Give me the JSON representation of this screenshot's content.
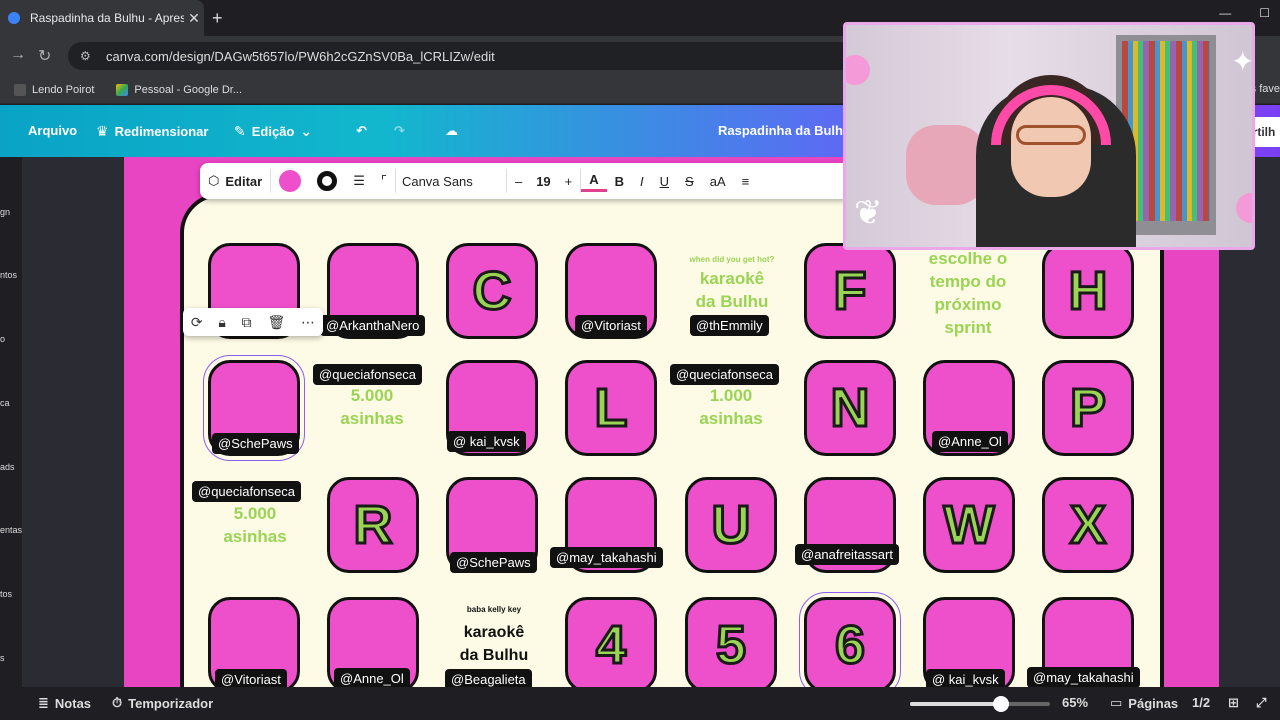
{
  "browser": {
    "tab_title": "Raspadinha da Bulhu - Apresen",
    "url": "canva.com/design/DAGw5t657lo/PW6h2cGZnSV0Ba_lCRLIZw/edit",
    "bookmarks": [
      "Lendo Poirot",
      "Pessoal - Google Dr..."
    ],
    "bookmarks_right": "os fave"
  },
  "canva_header": {
    "file": "Arquivo",
    "resize": "Redimensionar",
    "edit": "Edição",
    "doc_title": "Raspadinha da Bulhu",
    "share": "artilh"
  },
  "left_strip": [
    "gn",
    "ntos",
    "o",
    "ca",
    "ads",
    "entas",
    "tos",
    "s"
  ],
  "text_toolbar": {
    "edit": "Editar",
    "font": "Canva Sans",
    "size": "19",
    "minus": "–",
    "plus": "+",
    "bold": "B",
    "italic": "I",
    "underline": "U",
    "strike": "S",
    "case": "aA",
    "text_color": "#ee4fcb"
  },
  "grid": {
    "row1": {
      "c3": "C",
      "c6": "F",
      "c8": "H",
      "h2": "@ArkanthaNero",
      "h4": "@Vitoriast",
      "small5": "when did you get hot?",
      "txt5": [
        "karaokê",
        "da Bulhu"
      ],
      "h5": "@thEmmily",
      "txt7": [
        "escolhe o",
        "tempo do",
        "próximo",
        "sprint"
      ]
    },
    "row2": {
      "h1": "@SchePaws",
      "h2": "@queciafonseca",
      "txt2": [
        "5.000",
        "asinhas"
      ],
      "h3": "@ kai_kvsk",
      "c4": "L",
      "h5": "@queciafonseca",
      "txt5": [
        "1.000",
        "asinhas"
      ],
      "c6": "N",
      "h7": "@Anne_Ol",
      "c8": "P"
    },
    "row3": {
      "h1": "@queciafonseca",
      "txt1": [
        "5.000",
        "asinhas"
      ],
      "c2": "R",
      "h3": "@SchePaws",
      "h4": "@may_takahashi",
      "c5": "U",
      "h6": "@anafreitassart",
      "c7": "W",
      "c8": "X"
    },
    "row4": {
      "h1": "@Vitoriast",
      "h2": "@Anne_Ol",
      "small3": "baba kelly key",
      "txt3": [
        "karaokê",
        "da Bulhu"
      ],
      "h3": "@Beagalieta",
      "c4": "4",
      "c5": "5",
      "c6": "6",
      "h7": "@ kai_kvsk",
      "h8": "@may_takahashi"
    }
  },
  "bottom": {
    "notes": "Notas",
    "timer": "Temporizador",
    "zoom": "65%",
    "zoom_level": 0.65,
    "pages": "Páginas",
    "page_count": "1/2"
  },
  "colors": {
    "pink": "#ee4fcb",
    "green": "#9ad454",
    "cream": "#fdfbe5"
  }
}
